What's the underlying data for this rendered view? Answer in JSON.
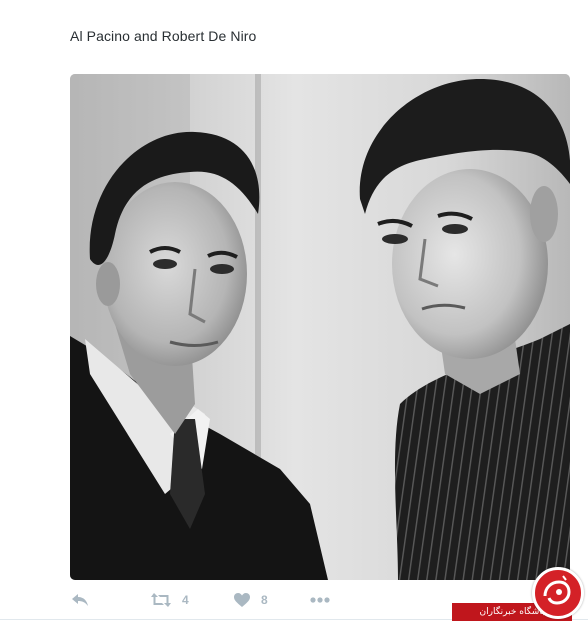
{
  "tweet": {
    "text": "Al Pacino and Robert De Niro"
  },
  "media": {
    "icon": "photo-black-and-white"
  },
  "actions": {
    "reply": {
      "icon": "reply-icon"
    },
    "retweet": {
      "icon": "retweet-icon",
      "count": "4"
    },
    "like": {
      "icon": "heart-icon",
      "count": "8"
    },
    "more": {
      "icon": "more-dots-icon"
    }
  },
  "watermark": {
    "text": "باشگاه خبرنگاران",
    "accent": "#c0161c"
  },
  "colors": {
    "text": "#292f33",
    "action_gray": "#aab8c2"
  }
}
